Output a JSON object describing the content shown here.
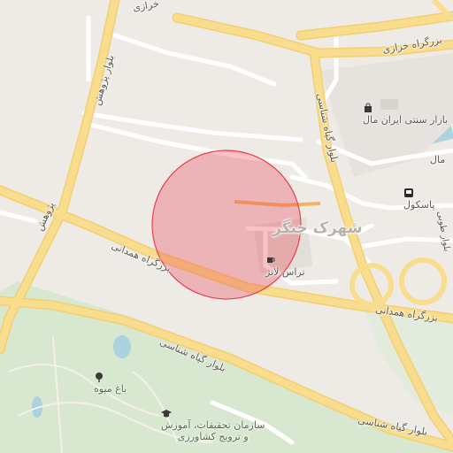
{
  "map": {
    "highlight_color": "#e8414f",
    "labels": {
      "kharazi_top": "خرازی",
      "kharazi_highway": "بزرگراه خرازی",
      "pajuhesh_upper": "بلوار پژوهش",
      "pajuhesh_lower": "پژوهش",
      "hamedani_west": "بزرگراه همدانی",
      "hamedani_east": "بزرگراه همدانی",
      "giahshenasi_north": "بلوار گیاه شناسی",
      "giahshenasi_south": "بلوار گیاه شناسی",
      "giahshenasi_se": "بلوار گیاه شناسی",
      "district": "شهرک چنگر",
      "mall_road": "مال",
      "east_road": "بلوار طوبی"
    },
    "pois": {
      "bazaar": {
        "label": "بازار سنتی ایران مال",
        "icon": "shopping-bag-icon"
      },
      "station": {
        "label": "پاسکول",
        "icon": "metro-station-icon"
      },
      "terrace": {
        "label": "تراس لانژ",
        "icon": "coffee-cup-icon"
      },
      "orchard": {
        "label": "باغ میوه",
        "icon": "tree-icon"
      },
      "research_org": {
        "label_line1": "سازمان تحقیقات، آموزش",
        "label_line2": "و ترویج کشاورزی",
        "icon": "graduation-cap-icon"
      }
    }
  }
}
